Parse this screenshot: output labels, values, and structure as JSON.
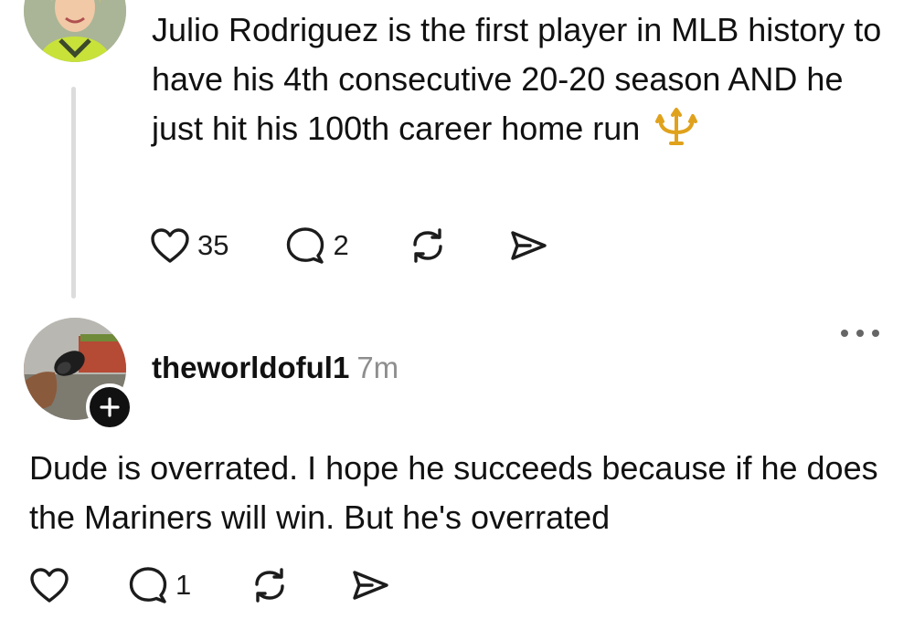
{
  "post": {
    "text": "Julio Rodriguez is the first player in MLB history to have his 4th consecutive 20-20 season AND he just hit his 100th career home run",
    "emoji_icon": "trident-emoji-icon",
    "likes": "35",
    "replies": "2"
  },
  "reply": {
    "username": "theworldoful1",
    "timestamp": "7m",
    "text": "Dude is overrated. I hope he succeeds because if he does the Mariners will win. But he's overrated",
    "replies": "1"
  },
  "icons": {
    "like": "heart-icon",
    "comment": "comment-bubble-icon",
    "repost": "repost-icon",
    "share": "send-icon",
    "more": "more-horizontal-icon",
    "follow": "plus-icon"
  },
  "colors": {
    "text": "#111111",
    "muted": "#8e8e8e",
    "thread_line": "#dcdcdc",
    "emoji": "#e0a21c"
  }
}
